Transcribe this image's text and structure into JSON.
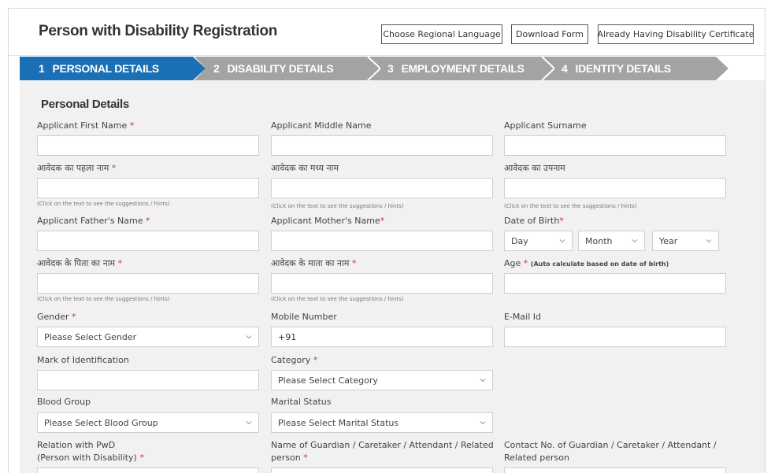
{
  "header": {
    "title": "Person with Disability Registration",
    "buttons": [
      "Choose Regional Language",
      "Download Form",
      "Already Having Disability Certificate"
    ]
  },
  "steps": [
    {
      "num": "1",
      "label": "PERSONAL DETAILS",
      "active": true
    },
    {
      "num": "2",
      "label": "DISABILITY DETAILS",
      "active": false
    },
    {
      "num": "3",
      "label": "EMPLOYMENT DETAILS",
      "active": false
    },
    {
      "num": "4",
      "label": "IDENTITY DETAILS",
      "active": false
    }
  ],
  "colors": {
    "active_step": "#1a6fb5",
    "inactive_step": "#a3a3a3",
    "required": "#c0392b"
  },
  "form": {
    "section_title": "Personal Details",
    "hint": "(Click on the text to see the suggestions / hints)",
    "required_mark": "*",
    "first_name": "Applicant First Name",
    "middle_name": "Applicant Middle Name",
    "surname": "Applicant Surname",
    "first_name_hi": "आवेदक का पहला नाम",
    "middle_name_hi": "आवेदक का मध्य नाम",
    "surname_hi": "आवेदक का उपनाम",
    "father_name": "Applicant Father's Name",
    "mother_name": "Applicant Mother's Name",
    "dob": "Date of Birth",
    "dob_day": "Day",
    "dob_month": "Month",
    "dob_year": "Year",
    "father_name_hi": "आवेदक के पिता का नाम",
    "mother_name_hi": "आवेदक के माता का नाम",
    "age": "Age",
    "age_note": "(Auto calculate based on date of birth)",
    "gender": "Gender",
    "gender_placeholder": "Please Select Gender",
    "mobile": "Mobile Number",
    "mobile_value": "+91",
    "email": "E-Mail Id",
    "mark_id": "Mark of Identification",
    "category": "Category",
    "category_placeholder": "Please Select Category",
    "blood_group": "Blood Group",
    "blood_group_placeholder": "Please Select Blood Group",
    "marital_status": "Marital Status",
    "marital_status_placeholder": "Please Select Marital Status",
    "relation_line1": "Relation with PwD",
    "relation_line2": "(Person with Disability)",
    "guardian_line1": "Name of Guardian / Caretaker / Attendant / Related",
    "guardian_line2": "person",
    "contact_line1": "Contact No. of Guardian / Caretaker / Attendant /",
    "contact_line2": "Related person"
  }
}
